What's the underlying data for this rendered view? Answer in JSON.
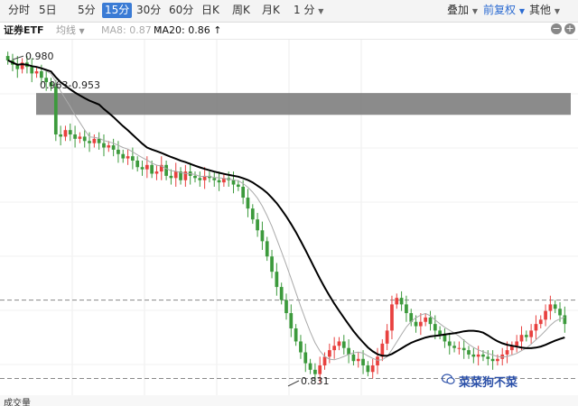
{
  "toolbar": {
    "periods": [
      "分时",
      "5日",
      "5分",
      "15分",
      "30分",
      "60分",
      "日K",
      "周K",
      "月K",
      "1 分"
    ],
    "active": "15分",
    "overlay": "叠加",
    "adjust": "前复权",
    "other": "其他"
  },
  "legend": {
    "symbol": "证券ETF",
    "avg_line": "均线",
    "ma8": "MA8: 0.87 ↑",
    "ma20": "MA20: 0.86 ↑"
  },
  "annotations": {
    "high": "0.980",
    "zone": "0.963-0.953",
    "low": "0.831"
  },
  "volume_label": "成交量",
  "watermark": "菜菜狗不菜",
  "colors": {
    "up": "#e8413f",
    "down": "#3c9a3c",
    "accent": "#3a7bd5",
    "ma20": "#000000",
    "ma8": "#aaaaaa",
    "zone": "#777777"
  },
  "chart_data": {
    "type": "candlestick",
    "interval": "15分",
    "ylim": [
      0.826,
      0.985
    ],
    "resistance_zone": [
      0.953,
      0.963
    ],
    "reference_levels": [
      0.868,
      0.832
    ],
    "close": [
      0.978,
      0.976,
      0.974,
      0.977,
      0.975,
      0.972,
      0.973,
      0.97,
      0.968,
      0.966,
      0.944,
      0.943,
      0.946,
      0.944,
      0.942,
      0.943,
      0.941,
      0.94,
      0.942,
      0.94,
      0.938,
      0.939,
      0.937,
      0.935,
      0.933,
      0.934,
      0.932,
      0.929,
      0.928,
      0.93,
      0.926,
      0.927,
      0.93,
      0.925,
      0.924,
      0.927,
      0.923,
      0.927,
      0.925,
      0.924,
      0.923,
      0.925,
      0.924,
      0.923,
      0.922,
      0.924,
      0.923,
      0.921,
      0.92,
      0.915,
      0.91,
      0.905,
      0.9,
      0.895,
      0.888,
      0.881,
      0.874,
      0.868,
      0.862,
      0.855,
      0.849,
      0.844,
      0.839,
      0.836,
      0.834,
      0.838,
      0.842,
      0.845,
      0.847,
      0.849,
      0.846,
      0.843,
      0.84,
      0.841,
      0.838,
      0.835,
      0.838,
      0.842,
      0.848,
      0.854,
      0.866,
      0.869,
      0.866,
      0.862,
      0.858,
      0.856,
      0.858,
      0.86,
      0.857,
      0.854,
      0.852,
      0.849,
      0.847,
      0.846,
      0.846,
      0.845,
      0.843,
      0.842,
      0.843,
      0.842,
      0.841,
      0.84,
      0.841,
      0.843,
      0.845,
      0.847,
      0.849,
      0.852,
      0.851,
      0.854,
      0.857,
      0.859,
      0.863,
      0.866,
      0.864,
      0.861,
      0.857
    ]
  }
}
